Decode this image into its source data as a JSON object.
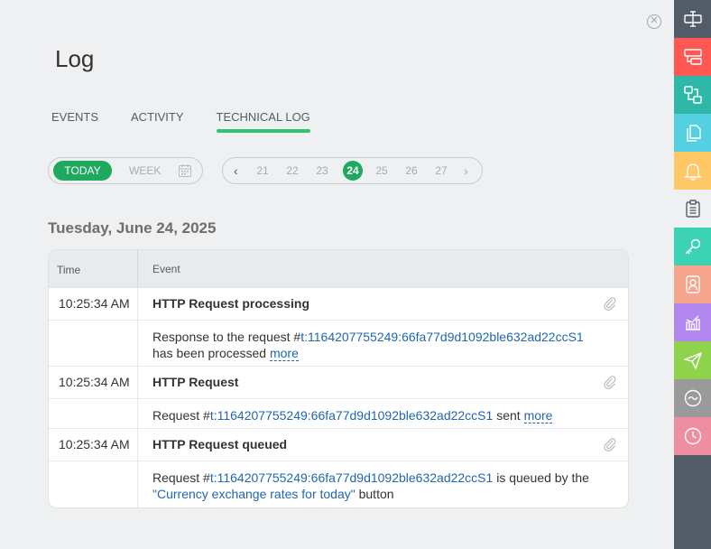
{
  "header": {
    "title": "Log"
  },
  "tabs": [
    {
      "label": "EVENTS",
      "active": false
    },
    {
      "label": "ACTIVITY",
      "active": false
    },
    {
      "label": "TECHNICAL LOG",
      "active": true
    }
  ],
  "period": {
    "today_label": "TODAY",
    "week_label": "WEEK",
    "selected": "TODAY"
  },
  "days": {
    "values": [
      "21",
      "22",
      "23",
      "24",
      "25",
      "26",
      "27"
    ],
    "selected": "24"
  },
  "date_heading": "Tuesday, June 24, 2025",
  "table": {
    "columns": {
      "time": "Time",
      "event": "Event"
    },
    "entries": [
      {
        "time": "10:25:34 AM",
        "title": "HTTP Request processing",
        "detail_prefix": "Response to the request #",
        "request_id": "t:1164207755249:66fa77d9d1092ble632ad22ccS1",
        "detail_suffix": "has been processed",
        "more": "more"
      },
      {
        "time": "10:25:34 AM",
        "title": "HTTP Request",
        "detail_prefix": "Request #",
        "request_id": "t:1164207755249:66fa77d9d1092ble632ad22ccS1",
        "detail_suffix": "sent",
        "more": "more"
      },
      {
        "time": "10:25:34 AM",
        "title": "HTTP Request queued",
        "detail_prefix": "Request #",
        "request_id": "t:1164207755249:66fa77d9d1092ble632ad22ccS1",
        "detail_mid": "is queued by the",
        "button_name": "\"Currency exchange rates for today\"",
        "detail_suffix": "button"
      }
    ]
  },
  "rail": {
    "items": [
      {
        "icon": "form-icon",
        "color": "#535c69"
      },
      {
        "icon": "layout-icon",
        "color": "#ff5752"
      },
      {
        "icon": "flow-icon",
        "color": "#2fb7a8"
      },
      {
        "icon": "documents-icon",
        "color": "#55d0e0"
      },
      {
        "icon": "bell-icon",
        "color": "#ffc766"
      },
      {
        "icon": "clipboard-icon",
        "color": "#eef0f1"
      },
      {
        "icon": "key-icon",
        "color": "#3bd3b3"
      },
      {
        "icon": "contact-icon",
        "color": "#f7a68d"
      },
      {
        "icon": "chart-icon",
        "color": "#b288f0"
      },
      {
        "icon": "send-icon",
        "color": "#8fd24b"
      },
      {
        "icon": "wave-icon",
        "color": "#9a9a9a"
      },
      {
        "icon": "clock-icon",
        "color": "#ee8ea0"
      }
    ]
  }
}
